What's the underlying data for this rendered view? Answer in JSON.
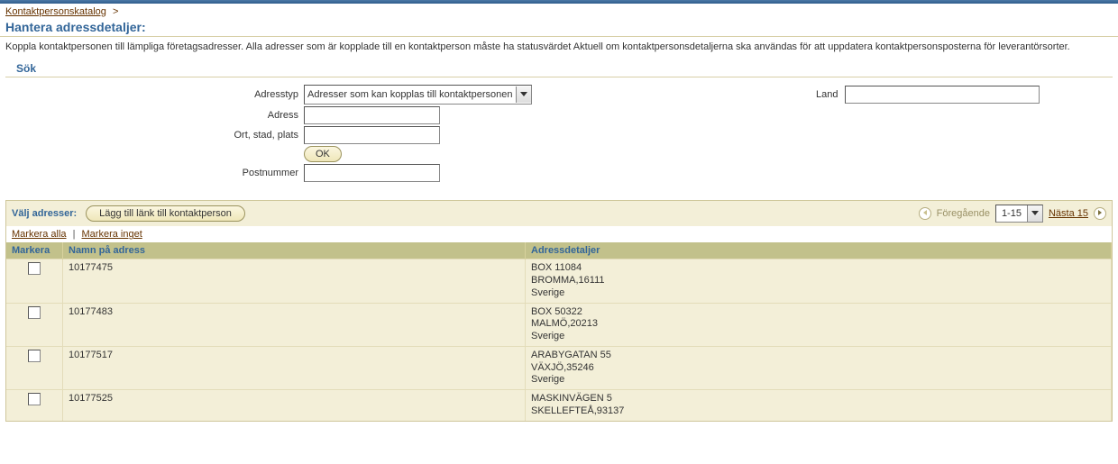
{
  "breadcrumb": {
    "link": "Kontaktpersonskatalog",
    "sep": ">"
  },
  "page_title": "Hantera adressdetaljer:",
  "intro": "Koppla kontaktpersonen till lämpliga företagsadresser. Alla adresser som är kopplade till en kontaktperson måste ha statusvärdet Aktuell om kontaktpersonsdetaljerna ska användas för att uppdatera kontaktpersonsposterna för leverantörsorter.",
  "sok_heading": "Sök",
  "form": {
    "adresstyp_label": "Adresstyp",
    "adresstyp_value": "Adresser som kan kopplas till kontaktpersonen",
    "adress_label": "Adress",
    "adress_value": "",
    "ort_label": "Ort, stad, plats",
    "ort_value": "",
    "post_label": "Postnummer",
    "post_value": "",
    "land_label": "Land",
    "land_value": "",
    "ok_button": "OK"
  },
  "panel": {
    "title": "Välj adresser:",
    "add_button": "Lägg till länk till kontaktperson",
    "prev": "Föregående",
    "range": "1-15",
    "next": "Nästa 15"
  },
  "select_links": {
    "all": "Markera alla",
    "none": "Markera inget"
  },
  "columns": {
    "mark": "Markera",
    "name": "Namn på adress",
    "details": "Adressdetaljer"
  },
  "rows": [
    {
      "name": "10177475",
      "lines": [
        "BOX 11084",
        "BROMMA,16111",
        "Sverige"
      ]
    },
    {
      "name": "10177483",
      "lines": [
        "BOX 50322",
        "MALMÖ,20213",
        "Sverige"
      ]
    },
    {
      "name": "10177517",
      "lines": [
        "ARABYGATAN 55",
        "VÄXJÖ,35246",
        "Sverige"
      ]
    },
    {
      "name": "10177525",
      "lines": [
        "MASKINVÄGEN 5",
        "SKELLEFTEÅ,93137"
      ]
    }
  ]
}
